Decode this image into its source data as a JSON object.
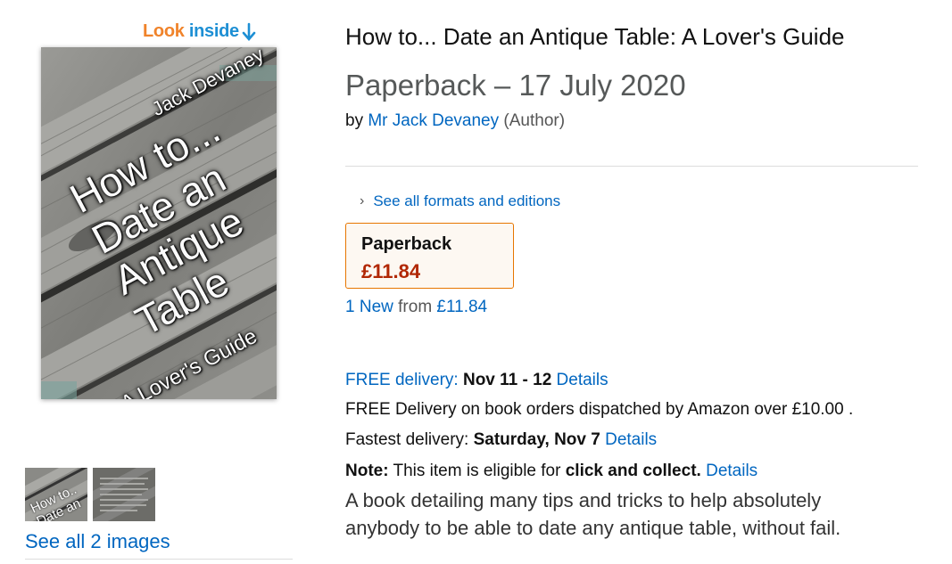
{
  "look_inside": {
    "part1": "Look ",
    "part2": "inside"
  },
  "cover": {
    "author": "Jack Devaney",
    "title_lines": [
      "How to...",
      "Date an",
      "Antique",
      "Table"
    ],
    "subtitle": "A Lover's Guide"
  },
  "thumbnails": [
    {
      "name": "thumbnail-cover",
      "text_lines": [
        "How to..",
        "Date an"
      ]
    },
    {
      "name": "thumbnail-page"
    }
  ],
  "see_all_images": "See all 2 images",
  "product": {
    "title": "How to... Date an Antique Table: A Lover's Guide",
    "subtitle": "Paperback – 17 July 2020",
    "by_label": "by",
    "author_name": "Mr Jack Devaney",
    "author_role": "(Author)"
  },
  "formats": {
    "see_all_label": "See all formats and editions",
    "selected": {
      "name": "Paperback",
      "price": "£11.84"
    },
    "offer": {
      "count": "1 New",
      "from": "from",
      "price": "£11.84"
    }
  },
  "delivery": {
    "label": "FREE delivery:",
    "dates": "Nov 11 - 12",
    "details": "Details",
    "free_note": "FREE Delivery on book orders dispatched by Amazon over £10.00 .",
    "fastest_label": "Fastest delivery:",
    "fastest_date": "Saturday, Nov 7",
    "fastest_details": "Details"
  },
  "note": {
    "label": "Note:",
    "text": "This item is eligible for",
    "bold": "click and collect.",
    "details": "Details"
  },
  "description": "A book detailing many tips and tricks to help absolutely anybody to be able to date any antique table, without fail.",
  "colors": {
    "link": "#0066c0",
    "price": "#b12704",
    "format_border": "#e77600",
    "look_inside_orange": "#f0832a",
    "look_inside_blue": "#1d8fd4"
  }
}
